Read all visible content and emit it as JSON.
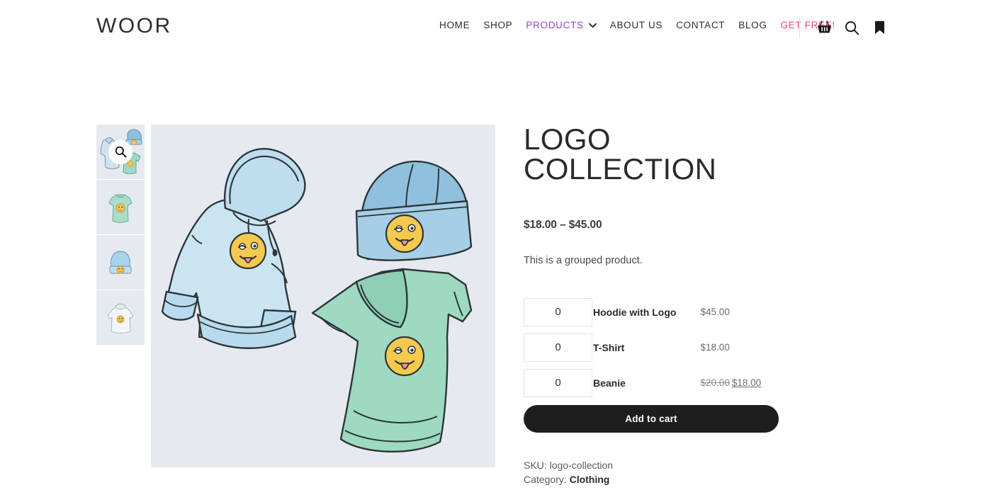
{
  "header": {
    "logo": "WOOR",
    "nav": [
      {
        "label": "HOME",
        "state": "default"
      },
      {
        "label": "SHOP",
        "state": "default"
      },
      {
        "label": "PRODUCTS",
        "state": "active",
        "has_dropdown": true
      },
      {
        "label": "ABOUT US",
        "state": "default"
      },
      {
        "label": "CONTACT",
        "state": "default"
      },
      {
        "label": "BLOG",
        "state": "default"
      },
      {
        "label": "GET FREE!",
        "state": "promo"
      }
    ],
    "tools": [
      {
        "icon": "basket-icon"
      },
      {
        "icon": "search-icon"
      },
      {
        "icon": "bookmark-icon"
      }
    ],
    "colors": {
      "active_nav": "#8e44c8",
      "promo_nav": "#f0486e",
      "text": "#2e2e2e"
    }
  },
  "gallery": {
    "zoom_icon": "search-icon",
    "thumbnails": [
      {
        "alt": "logo-collection-group",
        "selected": true
      },
      {
        "alt": "t-shirt-mint",
        "selected": false
      },
      {
        "alt": "beanie-blue",
        "selected": false
      },
      {
        "alt": "hoodie-white",
        "selected": false
      }
    ],
    "main_image_alt": "hoodie-beanie-tshirt-illustration",
    "background_color": "#e4eaef"
  },
  "product": {
    "title": "LOGO COLLECTION",
    "price_range": "$18.00 – $45.00",
    "description": "This is a grouped product.",
    "grouped_items": [
      {
        "qty": "0",
        "name": "Hoodie with Logo",
        "price": "$45.00",
        "regular_price": "",
        "sale_price": "",
        "on_sale": false
      },
      {
        "qty": "0",
        "name": "T-Shirt",
        "price": "$18.00",
        "regular_price": "",
        "sale_price": "",
        "on_sale": false
      },
      {
        "qty": "0",
        "name": "Beanie",
        "price": "",
        "regular_price": "$20.00",
        "sale_price": "$18.00",
        "on_sale": true
      }
    ],
    "add_to_cart_label": "Add to cart",
    "sku_label": "SKU:",
    "sku_value": "logo-collection",
    "category_label": "Category:",
    "category_value": "Clothing"
  }
}
